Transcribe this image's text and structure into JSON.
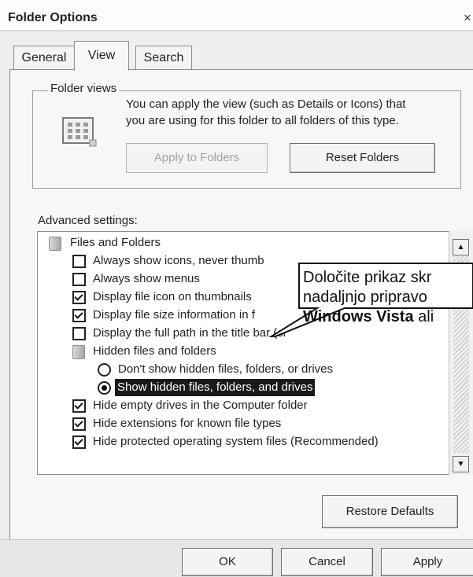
{
  "window": {
    "title": "Folder Options",
    "close_glyph": "×"
  },
  "tabs": [
    {
      "label": "General",
      "active": false
    },
    {
      "label": "View",
      "active": true
    },
    {
      "label": "Search",
      "active": false
    }
  ],
  "folder_views": {
    "legend": "Folder views",
    "description_line1": "You can apply the view (such as Details or Icons) that",
    "description_line2": "you are using for this folder to all folders of this type.",
    "apply_button": "Apply to Folders",
    "reset_button": "Reset Folders",
    "icon": "folder-view-grid-icon"
  },
  "advanced": {
    "label": "Advanced settings:",
    "items": [
      {
        "type": "folder",
        "label": "Files and Folders"
      },
      {
        "type": "checkbox",
        "label": "Always show icons, never thumb",
        "checked": false
      },
      {
        "type": "checkbox",
        "label": "Always show menus",
        "checked": false
      },
      {
        "type": "checkbox",
        "label": "Display file icon on thumbnails",
        "checked": true
      },
      {
        "type": "checkbox",
        "label": "Display file size information in f",
        "checked": true
      },
      {
        "type": "checkbox",
        "label": "Display the full path in the title bar (cl",
        "checked": false
      },
      {
        "type": "folder",
        "label": "Hidden files and folders"
      },
      {
        "type": "radio",
        "label": "Don't show hidden files, folders, or drives",
        "checked": false
      },
      {
        "type": "radio",
        "label": "Show hidden files, folders, and drives",
        "checked": true
      },
      {
        "type": "checkbox",
        "label": "Hide empty drives in the Computer folder",
        "checked": true
      },
      {
        "type": "checkbox",
        "label": "Hide extensions for known file types",
        "checked": true
      },
      {
        "type": "checkbox",
        "label": "Hide protected operating system files (Recommended)",
        "checked": true
      }
    ]
  },
  "callout": {
    "line1": "Določite prikaz skr",
    "line2": "nadaljnjo pripravo",
    "line3_bold": "Windows Vista",
    "line3_rest": " ali"
  },
  "restore_button": "Restore Defaults",
  "footer": {
    "ok": "OK",
    "cancel": "Cancel",
    "apply": "Apply"
  },
  "colors": {
    "selection": "#1a1a1a",
    "dialog_background": "#efefef"
  }
}
